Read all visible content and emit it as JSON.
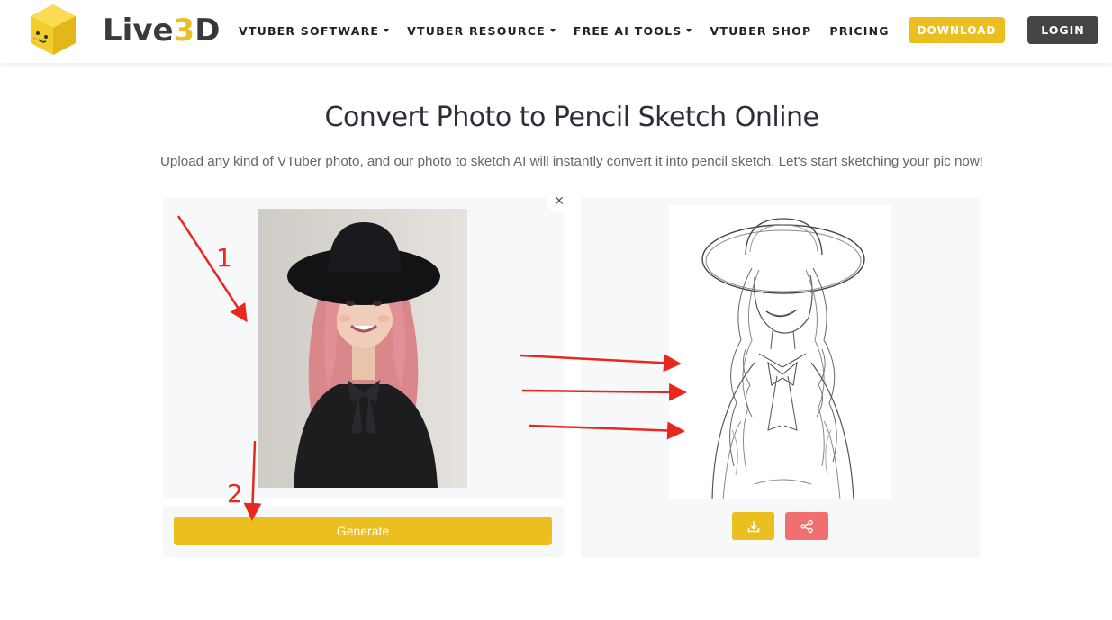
{
  "header": {
    "logo_text_live": "Live",
    "logo_text_3": "3",
    "logo_text_d": "D",
    "nav": [
      {
        "label": "VTUBER SOFTWARE",
        "has_dropdown": true
      },
      {
        "label": "VTUBER RESOURCE",
        "has_dropdown": true
      },
      {
        "label": "FREE AI TOOLS",
        "has_dropdown": true
      },
      {
        "label": "VTUBER SHOP",
        "has_dropdown": false
      },
      {
        "label": "PRICING",
        "has_dropdown": false
      }
    ],
    "download_label": "DOWNLOAD",
    "login_label": "LOGIN"
  },
  "main": {
    "title": "Convert Photo to Pencil Sketch Online",
    "subtitle": "Upload any kind of VTuber photo, and our photo to sketch AI will instantly convert it into pencil sketch. Let's start sketching your pic now!",
    "close_glyph": "×",
    "generate_label": "Generate"
  },
  "annotations": {
    "step1": "1",
    "step2": "2"
  },
  "icons": {
    "download": "download-icon",
    "share": "share-icon",
    "close": "close-icon"
  },
  "colors": {
    "accent": "#ecbf20",
    "dark": "#444444",
    "share": "#f07070",
    "annotation": "#e8281e"
  }
}
